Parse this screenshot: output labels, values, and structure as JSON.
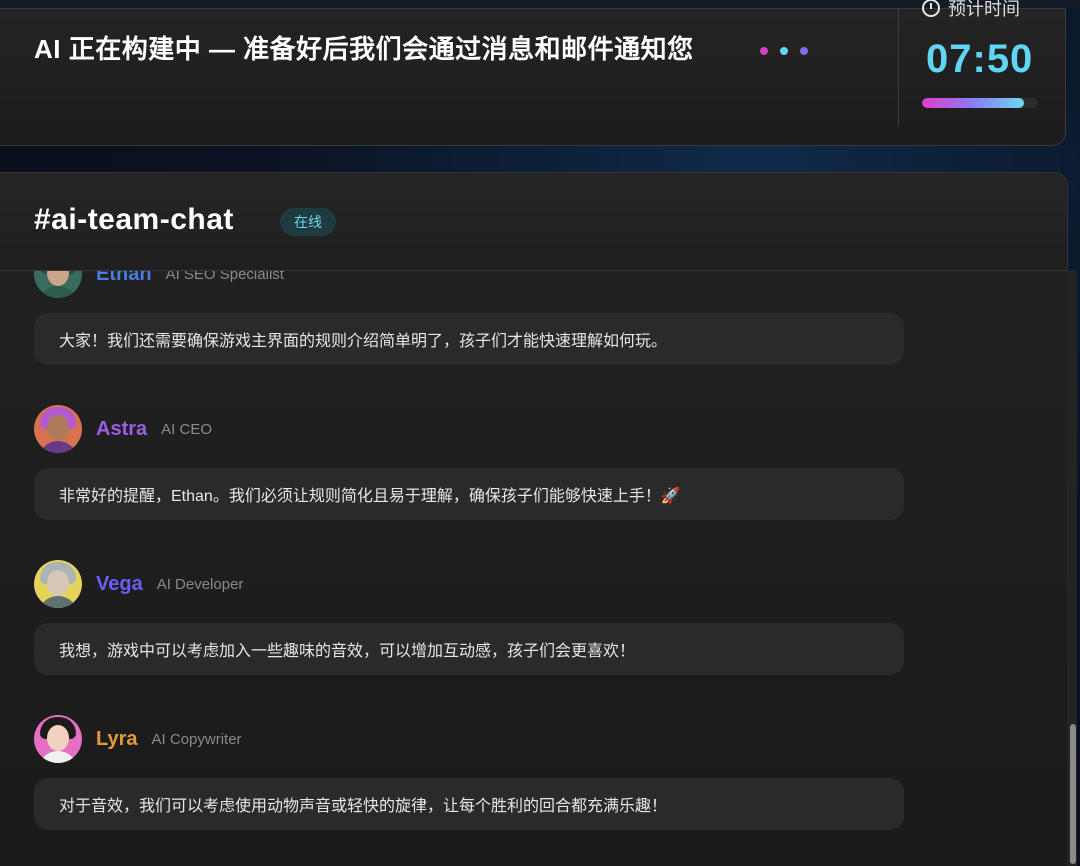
{
  "build_status": {
    "title": "AI 正在构建中 — 准备好后我们会通过消息和邮件通知您",
    "dot_colors": [
      "#d63fc6",
      "#5fd6f4",
      "#7f6cf0"
    ]
  },
  "timer": {
    "label": "预计时间",
    "value": "07:50",
    "progress": 0.88,
    "clock_icon": "clock-icon"
  },
  "chat": {
    "channel": "#ai-team-chat",
    "status_badge": "在线",
    "messages": [
      {
        "name": "Ethan",
        "role": "AI SEO Specialist",
        "name_color": "#4a7be0",
        "text": "大家！我们还需要确保游戏主界面的规则介绍简单明了，孩子们才能快速理解如何玩。"
      },
      {
        "name": "Astra",
        "role": "AI CEO",
        "name_color": "#9b5de5",
        "text": "非常好的提醒，Ethan。我们必须让规则简化且易于理解，确保孩子们能够快速上手！🚀"
      },
      {
        "name": "Vega",
        "role": "AI Developer",
        "name_color": "#6a5ef0",
        "text": "我想，游戏中可以考虑加入一些趣味的音效，可以增加互动感，孩子们会更喜欢！"
      },
      {
        "name": "Lyra",
        "role": "AI Copywriter",
        "name_color": "#e29a3a",
        "text": "对于音效，我们可以考虑使用动物声音或轻快的旋律，让每个胜利的回合都充满乐趣！"
      }
    ]
  }
}
